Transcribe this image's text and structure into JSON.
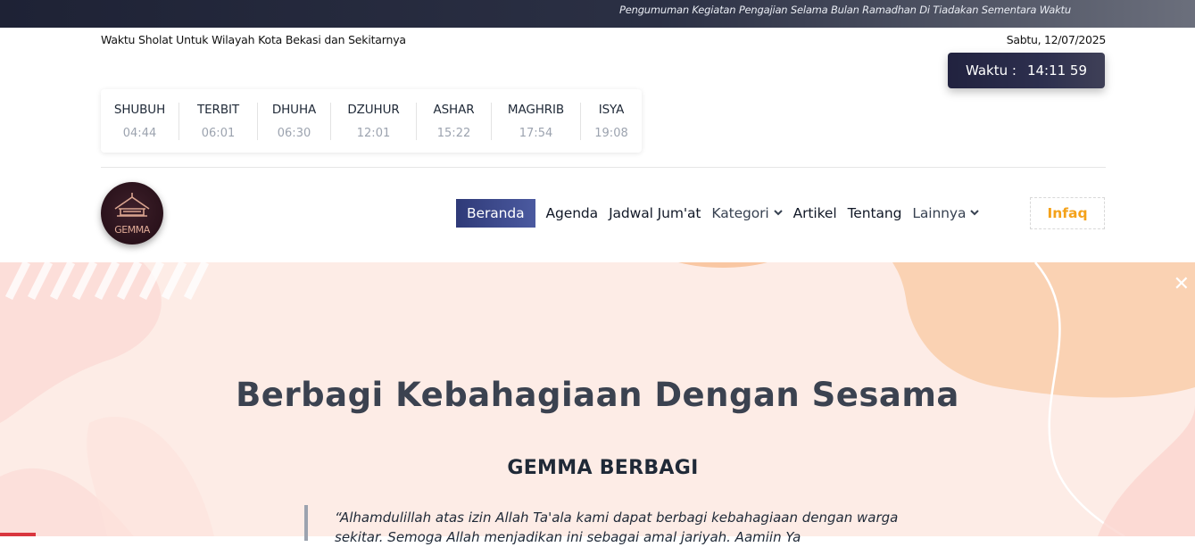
{
  "announcement": "Pengumuman Kegiatan Pengajian Selama Bulan Ramadhan Di Tiadakan Sementara Waktu",
  "prayer_header": "Waktu Sholat Untuk Wilayah Kota Bekasi dan Sekitarnya",
  "date": "Sabtu, 12/07/2025",
  "clock": {
    "label": "Waktu :",
    "time": "14:11 59"
  },
  "prayer_times": [
    {
      "name": "SHUBUH",
      "time": "04:44"
    },
    {
      "name": "TERBIT",
      "time": "06:01"
    },
    {
      "name": "DHUHA",
      "time": "06:30"
    },
    {
      "name": "DZUHUR",
      "time": "12:01"
    },
    {
      "name": "ASHAR",
      "time": "15:22"
    },
    {
      "name": "MAGHRIB",
      "time": "17:54"
    },
    {
      "name": "ISYA",
      "time": "19:08"
    }
  ],
  "logo_text": "GEMMA",
  "nav": {
    "items": [
      "Beranda",
      "Agenda",
      "Jadwal Jum'at",
      "Kategori",
      "Artikel",
      "Tentang",
      "Lainnya"
    ],
    "infaq": "Infaq"
  },
  "hero": {
    "heading": "Berbagi Kebahagiaan Dengan Sesama",
    "subheading": "GEMMA BERBAGI",
    "quote": "“Alhamdulillah atas izin Allah Ta'ala kami dapat berbagi kebahagiaan dengan warga sekitar. Semoga Allah menjadikan ini sebagai amal jariyah. Aamiin Ya"
  },
  "colors": {
    "accent": "#f4a21a",
    "nav_active": "#3c4890",
    "dark": "#21223f"
  }
}
